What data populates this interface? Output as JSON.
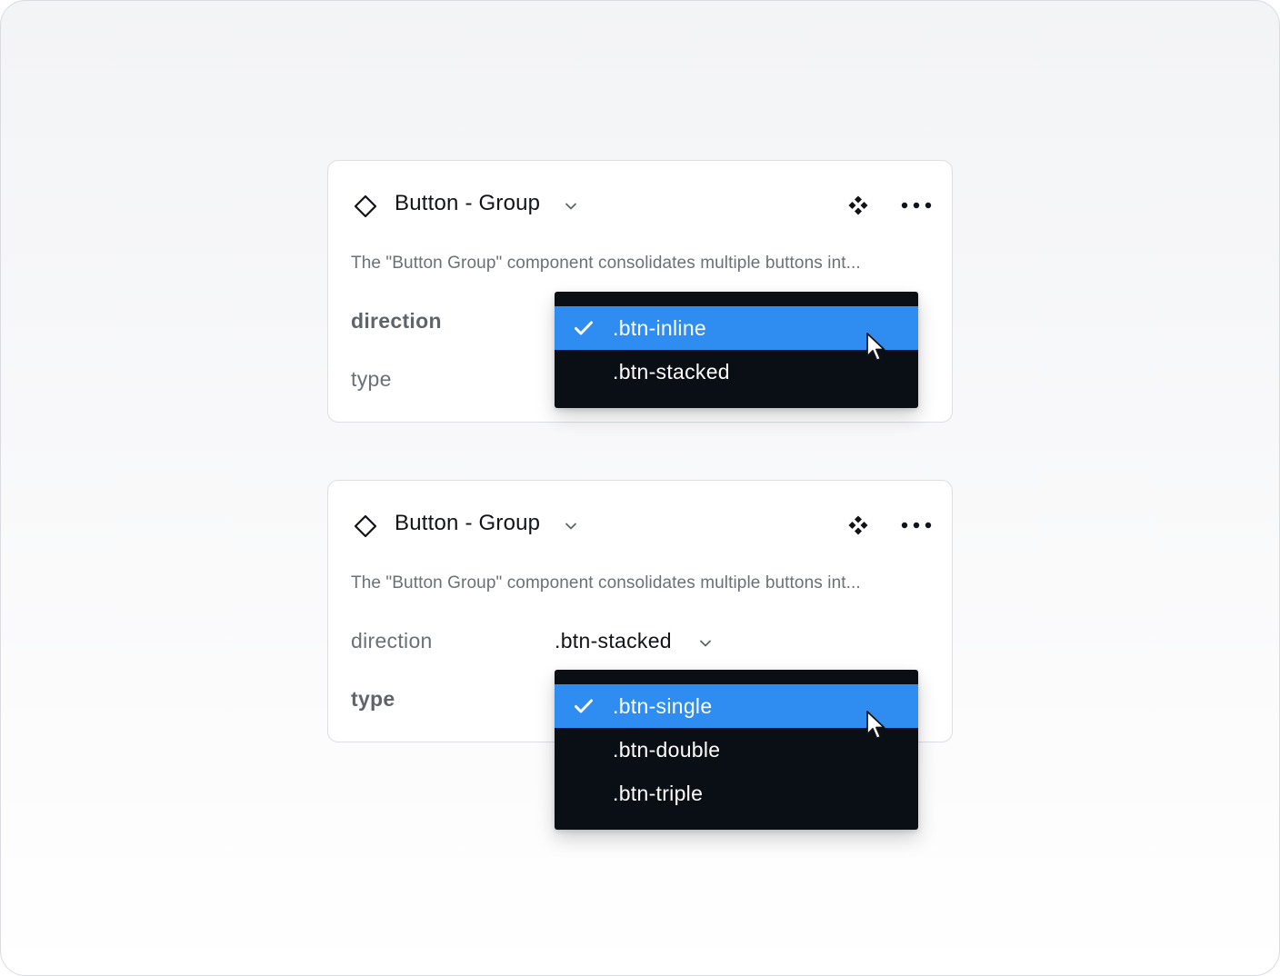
{
  "colors": {
    "accent": "#2f8cf0",
    "dropdown_bg": "#0a0e15",
    "text_primary": "#111318",
    "text_secondary": "#6b6f78"
  },
  "cards": [
    {
      "title": "Button - Group",
      "description": "The \"Button Group\" component consolidates multiple buttons int...",
      "props": {
        "direction_label": "direction",
        "type_label": "type"
      },
      "dropdown": {
        "options": [
          {
            "label": ".btn-inline",
            "selected": true
          },
          {
            "label": ".btn-stacked",
            "selected": false
          }
        ]
      }
    },
    {
      "title": "Button - Group",
      "description": "The \"Button Group\" component consolidates multiple buttons int...",
      "props": {
        "direction_label": "direction",
        "direction_value": ".btn-stacked",
        "type_label": "type"
      },
      "dropdown": {
        "options": [
          {
            "label": ".btn-single",
            "selected": true
          },
          {
            "label": ".btn-double",
            "selected": false
          },
          {
            "label": ".btn-triple",
            "selected": false
          }
        ]
      }
    }
  ],
  "icons": [
    "diamond-icon",
    "chevron-down-icon",
    "component-icon",
    "more-icon",
    "check-icon",
    "cursor-icon"
  ]
}
